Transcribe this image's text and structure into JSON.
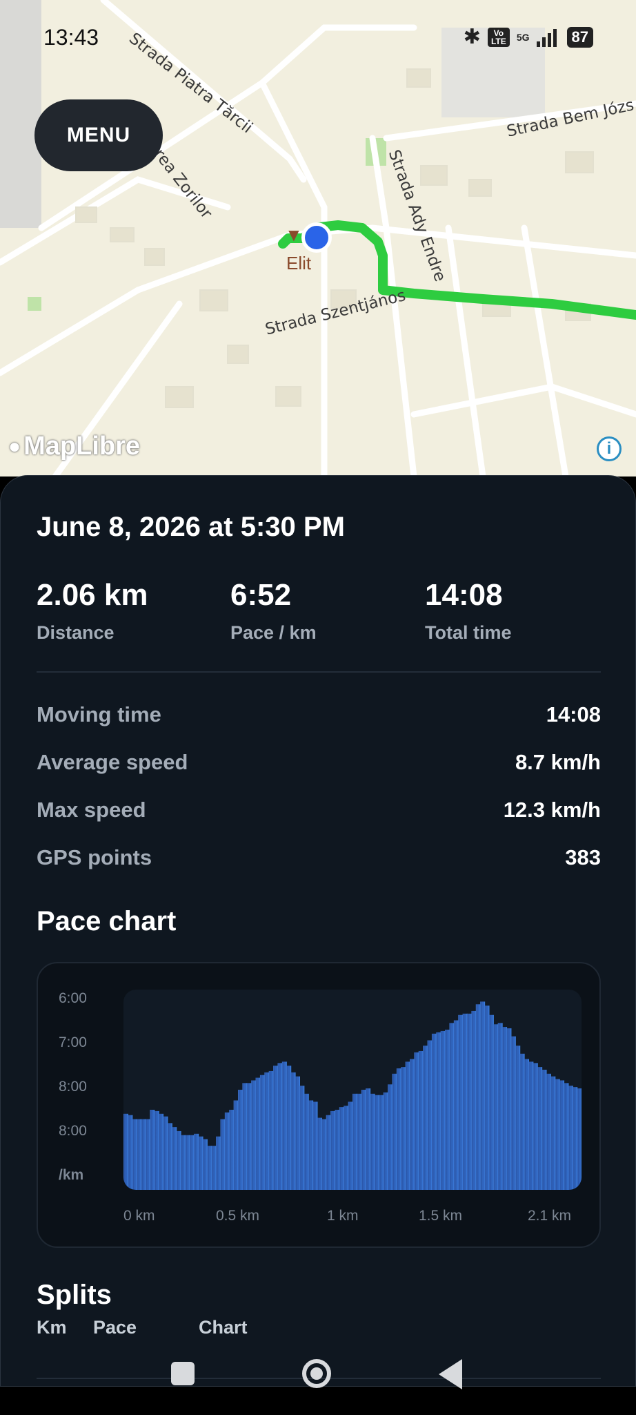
{
  "status_bar": {
    "time": "13:43",
    "battery": "87",
    "network": "5G",
    "volte": "Vo LTE"
  },
  "map": {
    "menu_label": "MENU",
    "attribution": "MapLibre",
    "poi_label": "Elit",
    "streets": [
      "Strada Piatra Tărcii",
      "Strada Bem Józs",
      "Strada Ady Endre",
      "Strada Szentjános",
      "rea Zorilor"
    ],
    "route_color": "#2ecc40",
    "location_color": "#2a64e8"
  },
  "run": {
    "title": "June 8, 2026 at 5:30 PM",
    "stats": [
      {
        "value": "2.06 km",
        "label": "Distance"
      },
      {
        "value": "6:52",
        "label": "Pace / km"
      },
      {
        "value": "14:08",
        "label": "Total time"
      }
    ],
    "details": [
      {
        "label": "Moving time",
        "value": "14:08"
      },
      {
        "label": "Average speed",
        "value": "8.7 km/h"
      },
      {
        "label": "Max speed",
        "value": "12.3 km/h"
      },
      {
        "label": "GPS points",
        "value": "383"
      }
    ]
  },
  "pace_chart": {
    "heading": "Pace chart"
  },
  "chart_data": {
    "type": "area",
    "y_ticks": [
      "6:00",
      "7:00",
      "8:00",
      "8:00"
    ],
    "y_unit": "/km",
    "x_ticks": [
      "0 km",
      "0.5 km",
      "1 km",
      "1.5 km",
      "2.1 km"
    ],
    "x": [
      0,
      0.02,
      0.04,
      0.06,
      0.08,
      0.1,
      0.12,
      0.14,
      0.16,
      0.18,
      0.2,
      0.22,
      0.24,
      0.26,
      0.28,
      0.3,
      0.32,
      0.34,
      0.36,
      0.38,
      0.4,
      0.42,
      0.44,
      0.46,
      0.48,
      0.5,
      0.52,
      0.54,
      0.56,
      0.58,
      0.6,
      0.62,
      0.64,
      0.66,
      0.68,
      0.7,
      0.72,
      0.74,
      0.76,
      0.78,
      0.8,
      0.82,
      0.84,
      0.86,
      0.88,
      0.9,
      0.92,
      0.94,
      0.96,
      0.98,
      1.0,
      1.02,
      1.04,
      1.06,
      1.08,
      1.1,
      1.12,
      1.14,
      1.16,
      1.18,
      1.2,
      1.22,
      1.24,
      1.26,
      1.28,
      1.3,
      1.32,
      1.34,
      1.36,
      1.38,
      1.4,
      1.42,
      1.44,
      1.46,
      1.48,
      1.5,
      1.52,
      1.54,
      1.56,
      1.58,
      1.6,
      1.62,
      1.64,
      1.66,
      1.68,
      1.7,
      1.72,
      1.74,
      1.76,
      1.78,
      1.8,
      1.82,
      1.84,
      1.86,
      1.88,
      1.9,
      1.92,
      1.94,
      1.96,
      1.98,
      2.0,
      2.02,
      2.04,
      2.06
    ],
    "values": [
      0.57,
      0.56,
      0.53,
      0.53,
      0.53,
      0.53,
      0.6,
      0.59,
      0.57,
      0.55,
      0.5,
      0.47,
      0.44,
      0.41,
      0.41,
      0.41,
      0.42,
      0.4,
      0.38,
      0.33,
      0.33,
      0.4,
      0.53,
      0.58,
      0.6,
      0.67,
      0.75,
      0.8,
      0.8,
      0.82,
      0.84,
      0.86,
      0.88,
      0.89,
      0.93,
      0.95,
      0.96,
      0.93,
      0.88,
      0.85,
      0.78,
      0.72,
      0.67,
      0.66,
      0.54,
      0.53,
      0.56,
      0.59,
      0.6,
      0.62,
      0.63,
      0.66,
      0.72,
      0.72,
      0.75,
      0.76,
      0.72,
      0.71,
      0.71,
      0.73,
      0.79,
      0.87,
      0.91,
      0.92,
      0.96,
      0.98,
      1.03,
      1.04,
      1.08,
      1.12,
      1.17,
      1.18,
      1.19,
      1.2,
      1.25,
      1.27,
      1.31,
      1.32,
      1.32,
      1.34,
      1.39,
      1.41,
      1.38,
      1.31,
      1.24,
      1.25,
      1.22,
      1.21,
      1.15,
      1.08,
      1.02,
      0.98,
      0.96,
      0.95,
      0.92,
      0.9,
      0.87,
      0.85,
      0.83,
      0.82,
      0.8,
      0.78,
      0.77,
      0.76
    ],
    "series": [
      {
        "color": "#3d7fe0"
      }
    ]
  },
  "splits": {
    "heading": "Splits",
    "columns": [
      "Km",
      "Pace",
      "Chart"
    ]
  }
}
